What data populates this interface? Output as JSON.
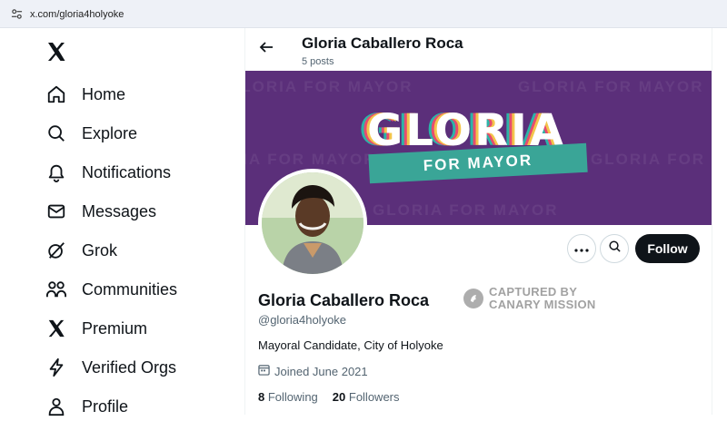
{
  "browser": {
    "url": "x.com/gloria4holyoke"
  },
  "sidebar": {
    "logo": "x-logo-icon",
    "items": [
      {
        "label": "Home",
        "icon": "home-icon"
      },
      {
        "label": "Explore",
        "icon": "search-icon"
      },
      {
        "label": "Notifications",
        "icon": "bell-icon"
      },
      {
        "label": "Messages",
        "icon": "mail-icon"
      },
      {
        "label": "Grok",
        "icon": "grok-icon"
      },
      {
        "label": "Communities",
        "icon": "people-icon"
      },
      {
        "label": "Premium",
        "icon": "x-premium-icon"
      },
      {
        "label": "Verified Orgs",
        "icon": "lightning-icon"
      },
      {
        "label": "Profile",
        "icon": "person-icon"
      }
    ]
  },
  "header": {
    "name": "Gloria Caballero Roca",
    "posts": "5 posts"
  },
  "banner": {
    "title": "GLORIA",
    "subtitle": "FOR MAYOR",
    "bg_word": "GLORIA FOR MAYOR"
  },
  "profile": {
    "name": "Gloria Caballero Roca",
    "handle": "@gloria4holyoke",
    "bio": "Mayoral Candidate, City of Holyoke",
    "joined": "Joined June 2021",
    "following_count": "8",
    "following_label": "Following",
    "followers_count": "20",
    "followers_label": "Followers",
    "follow_button": "Follow"
  },
  "watermark": {
    "line1": "CAPTURED BY",
    "line2": "CANARY MISSION"
  },
  "colors": {
    "accent": "#0f1419",
    "banner": "#5b2f7a",
    "ribbon": "#3aa597"
  }
}
